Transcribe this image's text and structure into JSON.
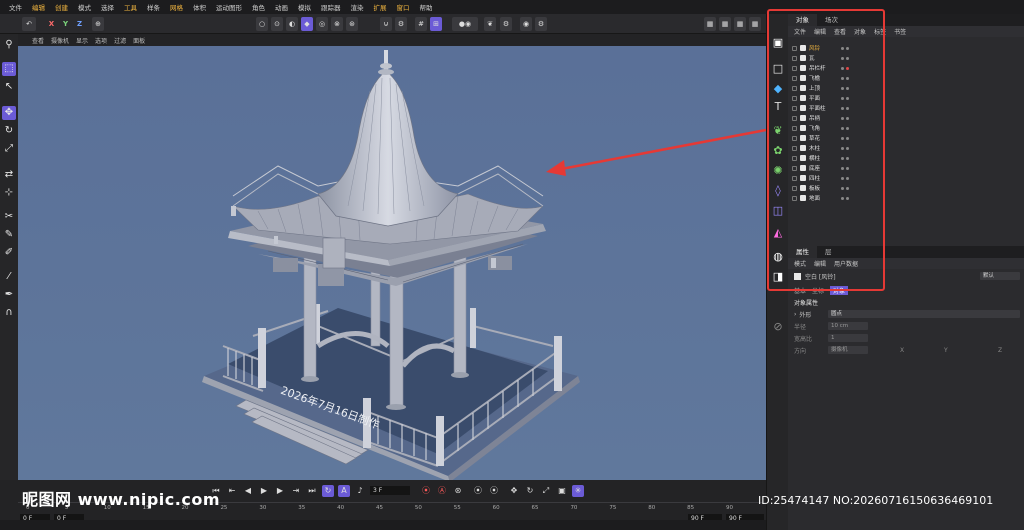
{
  "menu": [
    "文件",
    "编辑",
    "创建",
    "模式",
    "选择",
    "工具",
    "样条",
    "网格",
    "体积",
    "运动图形",
    "角色",
    "动画",
    "模拟",
    "跟踪器",
    "渲染",
    "扩展",
    "窗口",
    "帮助"
  ],
  "menu_highlight": [
    "编辑",
    "创建",
    "工具",
    "网格",
    "扩展",
    "窗口"
  ],
  "axis_labels": {
    "x": "X",
    "y": "Y",
    "z": "Z"
  },
  "viewport_menu": [
    "查看",
    "摄像机",
    "显示",
    "选项",
    "过滤",
    "面板"
  ],
  "viewport_text": "2026年7月16日制作",
  "object_panel": {
    "tabs": [
      "对象",
      "场次"
    ],
    "menu": [
      "文件",
      "编辑",
      "查看",
      "对象",
      "标签",
      "书签"
    ],
    "objects": [
      "风铃",
      "瓦",
      "吊栏杆",
      "飞檐",
      "上顶",
      "平面",
      "平面柱",
      "吊柄",
      "飞角",
      "草花",
      "木柱",
      "横柱",
      "底座",
      "四柱",
      "板板",
      "地面"
    ]
  },
  "attr_panel": {
    "tabs": [
      "属性",
      "层"
    ],
    "menu": [
      "模式",
      "编辑",
      "用户数据"
    ],
    "object_name": "空白 [风铃]",
    "preset": "默认",
    "subtabs": [
      "基本",
      "坐标",
      "对象"
    ],
    "section_title": "对象属性",
    "shape_label": "外形",
    "shape_value": "圆点",
    "radius_label": "半径",
    "radius_value": "10 cm",
    "aspect_label": "宽高比",
    "aspect_value": "1",
    "orient_label": "方向",
    "orient_value": "摄像机",
    "orient_axes": [
      "X",
      "Y",
      "Z"
    ]
  },
  "timeline": {
    "frame_field": "3 F",
    "ticks": [
      "0",
      "5",
      "10",
      "15",
      "20",
      "25",
      "30",
      "35",
      "40",
      "45",
      "50",
      "55",
      "60",
      "65",
      "70",
      "75",
      "80",
      "85",
      "90"
    ],
    "start_field": "0 F",
    "start_field2": "0 F",
    "end_field": "90 F",
    "end_field2": "90 F"
  },
  "watermarks": {
    "left": "昵图网 www.nipic.com",
    "right": "ID:25474147 NO:20260716150636469101"
  },
  "colors": {
    "accent": "#6b5bd6",
    "viewport_bg": "#5d7396",
    "highlight_box": "#e53935",
    "menu_highlight": "#f2b640"
  }
}
